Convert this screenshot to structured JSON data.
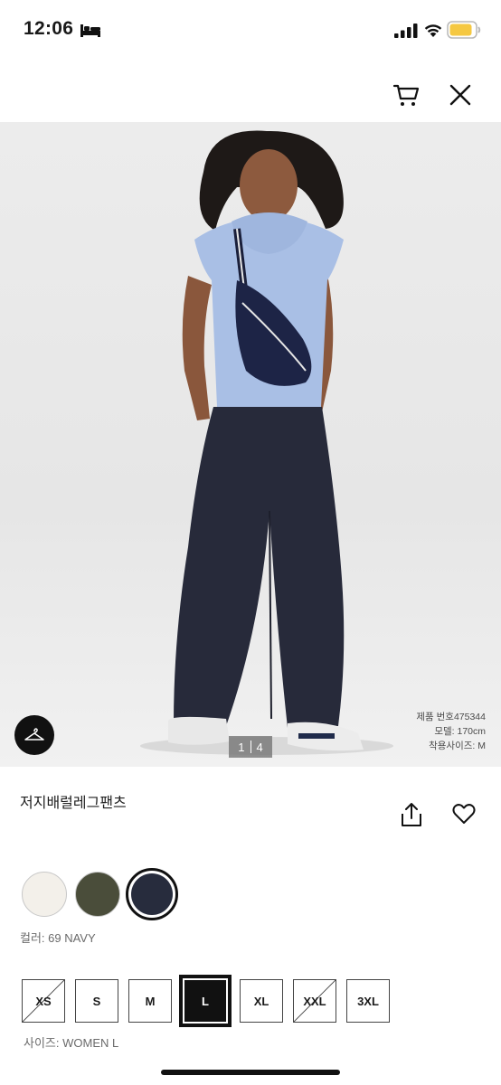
{
  "status_bar": {
    "time": "12:06",
    "icons": [
      "sleep-icon",
      "signal-icon",
      "wifi-icon",
      "battery-icon"
    ],
    "battery_color": "#f5c842"
  },
  "top_nav": {
    "icons": [
      "cart-icon",
      "close-icon"
    ]
  },
  "gallery": {
    "current": "1",
    "total": "4",
    "model_info": {
      "product_number": "제품 번호475344",
      "model_height": "모델: 170cm",
      "worn_size": "착용사이즈: M"
    },
    "try_on_icon": "hanger-icon"
  },
  "product": {
    "name": "저지배럴레그팬츠",
    "actions": [
      "share-icon",
      "heart-icon"
    ]
  },
  "colors": {
    "swatches": [
      {
        "name": "white",
        "hex": "#f3f0ea"
      },
      {
        "name": "olive",
        "hex": "#4a4d3a"
      },
      {
        "name": "navy",
        "hex": "#272c3d"
      }
    ],
    "selected_index": 2,
    "label": "컬러: 69 NAVY"
  },
  "sizes": {
    "options": [
      {
        "label": "XS",
        "available": false
      },
      {
        "label": "S",
        "available": true
      },
      {
        "label": "M",
        "available": true
      },
      {
        "label": "L",
        "available": true
      },
      {
        "label": "XL",
        "available": true
      },
      {
        "label": "XXL",
        "available": false
      },
      {
        "label": "3XL",
        "available": true
      }
    ],
    "selected": "L",
    "label": "사이즈: WOMEN L"
  }
}
